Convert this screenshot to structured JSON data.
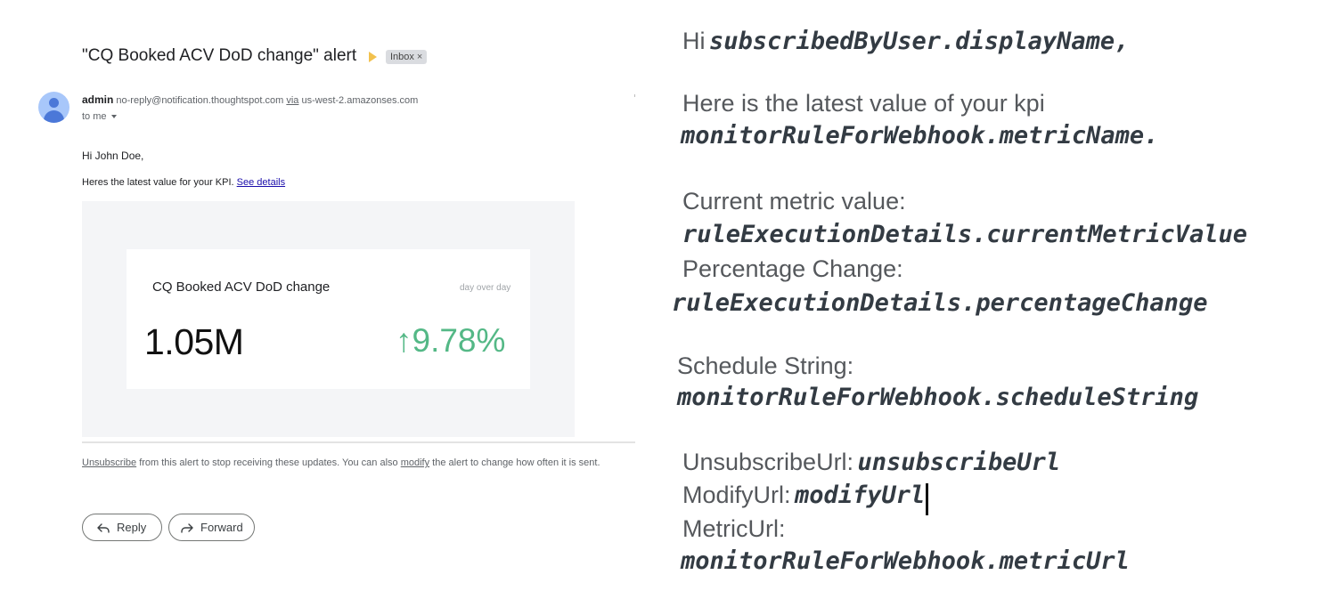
{
  "email": {
    "subject": "\"CQ Booked ACV DoD change\" alert",
    "inbox_chip": "Inbox",
    "inbox_chip_close": "×",
    "sender_name": "admin",
    "sender_email": "no-reply@notification.thoughtspot.com",
    "via_label": "via",
    "via_domain": "us-west-2.amazonses.com",
    "recipient": "to me",
    "greeting": "Hi John Doe,",
    "intro_text": "Heres the latest value for your KPI.",
    "see_details": "See details",
    "kpi": {
      "title": "CQ Booked ACV DoD change",
      "period": "day over day",
      "value": "1.05M",
      "change": "↑9.78%",
      "change_color": "#54b886"
    },
    "footer": {
      "unsubscribe": "Unsubscribe",
      "text1": " from this alert to stop receiving these updates. You can also ",
      "modify": "modify",
      "text2": " the alert to change how often it is sent."
    },
    "actions": {
      "reply": "Reply",
      "forward": "Forward"
    }
  },
  "template": {
    "greeting_prefix": "Hi",
    "greeting_var": "subscribedByUser.displayName,",
    "kpi_intro": "Here is the latest value of your kpi",
    "kpi_var": "monitorRuleForWebhook.metricName.",
    "current_label": "Current metric value:",
    "current_var": "ruleExecutionDetails.currentMetricValue",
    "pct_label": "Percentage Change:",
    "pct_var": "ruleExecutionDetails.percentageChange",
    "schedule_label": "Schedule String:",
    "schedule_var": "monitorRuleForWebhook.scheduleString",
    "unsub_label": "UnsubscribeUrl:",
    "unsub_var": "unsubscribeUrl",
    "modify_label": "ModifyUrl:",
    "modify_var": "modifyUrl",
    "metric_label": "MetricUrl:",
    "metric_var": "monitorRuleForWebhook.metricUrl"
  }
}
